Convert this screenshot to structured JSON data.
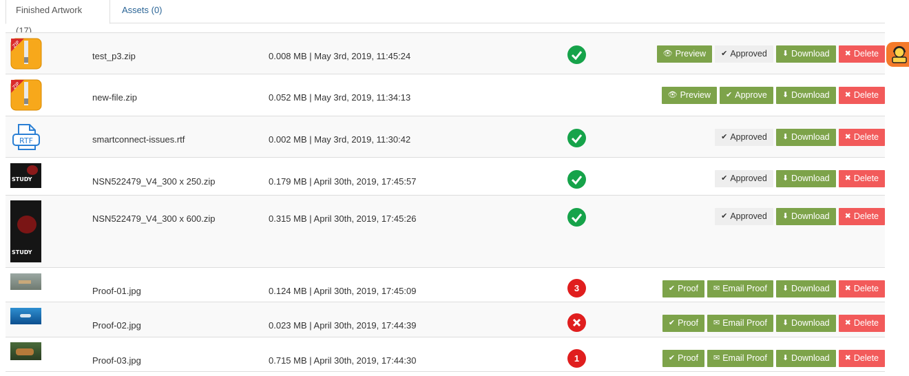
{
  "tabs": [
    {
      "label": "Finished Artwork (17)",
      "active": true
    },
    {
      "label": "Assets (0)",
      "active": false
    }
  ],
  "labels": {
    "preview": "Preview",
    "approved": "Approved",
    "approve": "Approve",
    "download": "Download",
    "delete": "Delete",
    "proof": "Proof",
    "email_proof": "Email Proof"
  },
  "colors": {
    "green_button": "#7da34a",
    "red_button": "#f25a5a",
    "status_ok": "#16a34a",
    "status_alert": "#e01e1e",
    "tab_link": "#2a6496"
  },
  "files": [
    {
      "name": "test_p3.zip",
      "meta": "0.008 MB | May 3rd, 2019, 11:45:24",
      "thumb": "zip-icon",
      "status": "approved-check"
    },
    {
      "name": "new-file.zip",
      "meta": "0.052 MB | May 3rd, 2019, 11:34:13",
      "thumb": "zip-icon",
      "status": "none"
    },
    {
      "name": "smartconnect-issues.rtf",
      "meta": "0.002 MB | May 3rd, 2019, 11:30:42",
      "thumb": "rtf-icon",
      "status": "approved-check"
    },
    {
      "name": "NSN522479_V4_300 x 250.zip",
      "meta": "0.179 MB | April 30th, 2019, 17:45:57",
      "thumb": "study-banner",
      "thumb_text": "STUDY",
      "status": "approved-check"
    },
    {
      "name": "NSN522479_V4_300 x 600.zip",
      "meta": "0.315 MB | April 30th, 2019, 17:45:26",
      "thumb": "study-banner",
      "thumb_text": "STUDY",
      "status": "approved-check"
    },
    {
      "name": "Proof-01.jpg",
      "meta": "0.124 MB | April 30th, 2019, 17:45:09",
      "thumb": "proof-image",
      "status": "count",
      "status_text": "3"
    },
    {
      "name": "Proof-02.jpg",
      "meta": "0.023 MB | April 30th, 2019, 17:44:39",
      "thumb": "proof-image",
      "status": "rejected-x"
    },
    {
      "name": "Proof-03.jpg",
      "meta": "0.715 MB | April 30th, 2019, 17:44:30",
      "thumb": "proof-image",
      "status": "count",
      "status_text": "1"
    }
  ]
}
